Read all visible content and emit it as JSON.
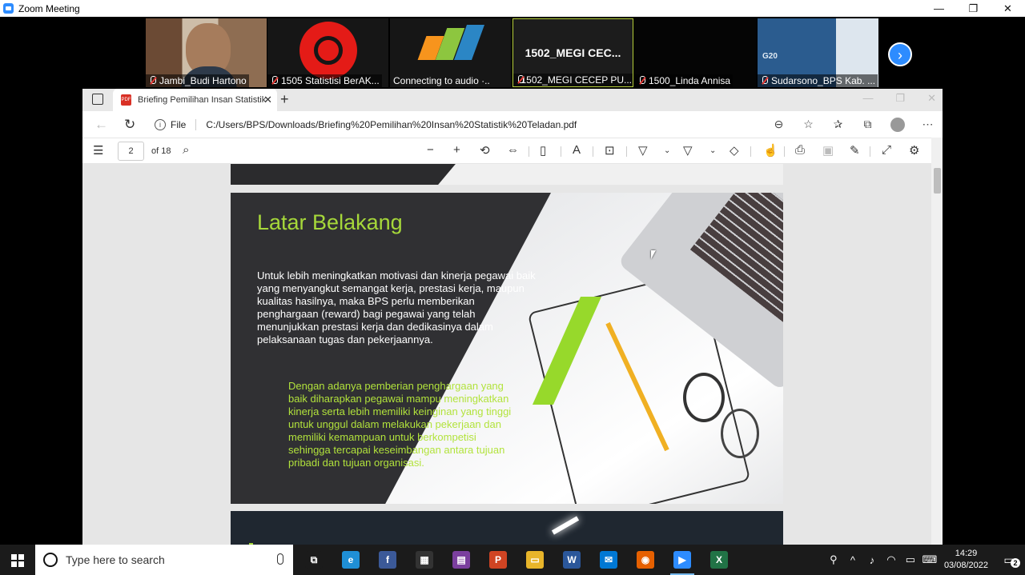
{
  "zoom": {
    "window_title": "Zoom Meeting",
    "controls": [
      "—",
      "❐",
      "✕"
    ],
    "participants": [
      {
        "name": "Jambi_Budi Hartono",
        "type": "video"
      },
      {
        "name": "1505 Statistisi BerAK...",
        "type": "logo-red"
      },
      {
        "name": "Connecting to audio ·..",
        "type": "logo-bps"
      },
      {
        "name": "1502_MEGI CECEP PU...",
        "type": "name",
        "display_name": "1502_MEGI CEC..."
      },
      {
        "name": "1500_Linda Annisa",
        "type": "black"
      },
      {
        "name": "Sudarsono_BPS Kab. ...",
        "type": "screen"
      }
    ],
    "next_label": "›"
  },
  "browser": {
    "tab_title": "Briefing Pemilihan Insan Statistik",
    "pdf_tag": "PDF",
    "file_label": "File",
    "url": "C:/Users/BPS/Downloads/Briefing%20Pemilihan%20Insan%20Statistik%20Teladan.pdf",
    "page_current": "2",
    "page_total_label": "of 18"
  },
  "slide": {
    "title": "Latar Belakang",
    "paragraph1": "Untuk lebih meningkatkan motivasi dan kinerja pegawai baik yang menyangkut semangat kerja, prestasi kerja, maupun kualitas hasilnya, maka BPS perlu memberikan penghargaan (reward) bagi pegawai yang telah menunjukkan prestasi kerja dan dedikasinya dalam pelaksanaan tugas dan pekerjaannya.",
    "paragraph2": "Dengan adanya pemberian penghargaan yang baik diharapkan pegawai mampu meningkatkan kinerja serta lebih memiliki keinginan yang tinggi untuk unggul dalam melakukan pekerjaan dan memiliki kemampuan untuk berkompetisi sehingga tercapai keseimbangan antara tujuan pribadi dan tujuan organisasi."
  },
  "taskbar": {
    "search_placeholder": "Type here to search",
    "apps": [
      {
        "name": "task-view",
        "glyph": "⧉",
        "color": "#1b1b1b"
      },
      {
        "name": "edge",
        "glyph": "e",
        "color": "#1f8fd6"
      },
      {
        "name": "facebook",
        "glyph": "f",
        "color": "#3b5998"
      },
      {
        "name": "store",
        "glyph": "▦",
        "color": "#333"
      },
      {
        "name": "winrar",
        "glyph": "▤",
        "color": "#7b3f9e"
      },
      {
        "name": "powerpoint",
        "glyph": "P",
        "color": "#d04423"
      },
      {
        "name": "file-explorer",
        "glyph": "▭",
        "color": "#e8b52a"
      },
      {
        "name": "word",
        "glyph": "W",
        "color": "#2b579a"
      },
      {
        "name": "mail",
        "glyph": "✉",
        "color": "#0078d4"
      },
      {
        "name": "firefox",
        "glyph": "◉",
        "color": "#e66000"
      },
      {
        "name": "zoom",
        "glyph": "▶",
        "color": "#2d8cff"
      },
      {
        "name": "excel",
        "glyph": "X",
        "color": "#217346"
      }
    ],
    "time": "14:29",
    "date": "03/08/2022",
    "notifications": "2"
  }
}
